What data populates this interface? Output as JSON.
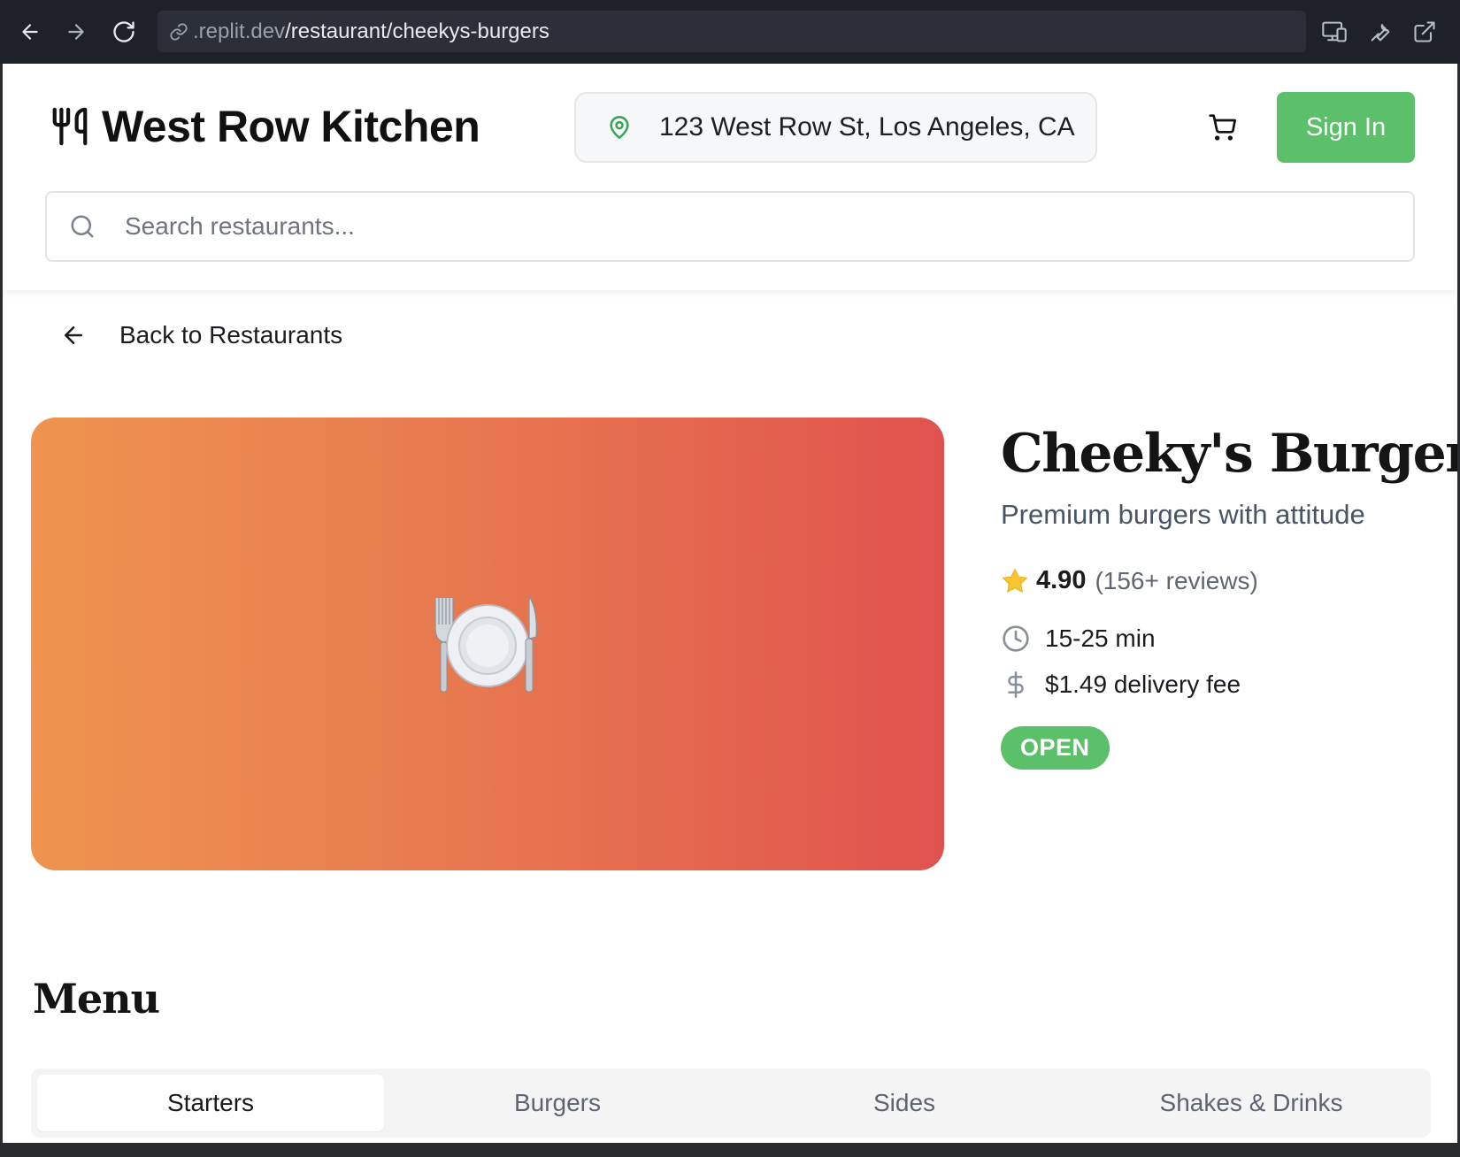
{
  "browser": {
    "url_prefix": ".replit.dev",
    "url_path": "/restaurant/cheekys-burgers"
  },
  "header": {
    "brand": "West Row Kitchen",
    "location": "123 West Row St, Los Angeles, CA",
    "signin_label": "Sign In",
    "search_placeholder": "Search restaurants..."
  },
  "back_link": "Back to Restaurants",
  "restaurant": {
    "name": "Cheeky's Burgers",
    "tagline": "Premium burgers with attitude",
    "rating": "4.90",
    "reviews": "(156+ reviews)",
    "delivery_time": "15-25 min",
    "delivery_fee": "$1.49 delivery fee",
    "status": "OPEN",
    "hero_gradient": [
      "#ee944f",
      "#e0524e"
    ]
  },
  "menu": {
    "title": "Menu",
    "tabs": [
      {
        "label": "Starters",
        "active": true
      },
      {
        "label": "Burgers",
        "active": false
      },
      {
        "label": "Sides",
        "active": false
      },
      {
        "label": "Shakes & Drinks",
        "active": false
      }
    ]
  },
  "colors": {
    "accent": "#5cbf6a",
    "chrome": "#1f2128"
  },
  "icons": [
    "back-arrow-icon",
    "forward-arrow-icon",
    "reload-icon",
    "link-icon",
    "devices-icon",
    "wrench-icon",
    "external-link-icon",
    "utensils-icon",
    "map-pin-icon",
    "cart-icon",
    "search-icon",
    "arrow-left-icon",
    "plate-cutlery-icon",
    "star-icon",
    "clock-icon",
    "dollar-icon"
  ]
}
